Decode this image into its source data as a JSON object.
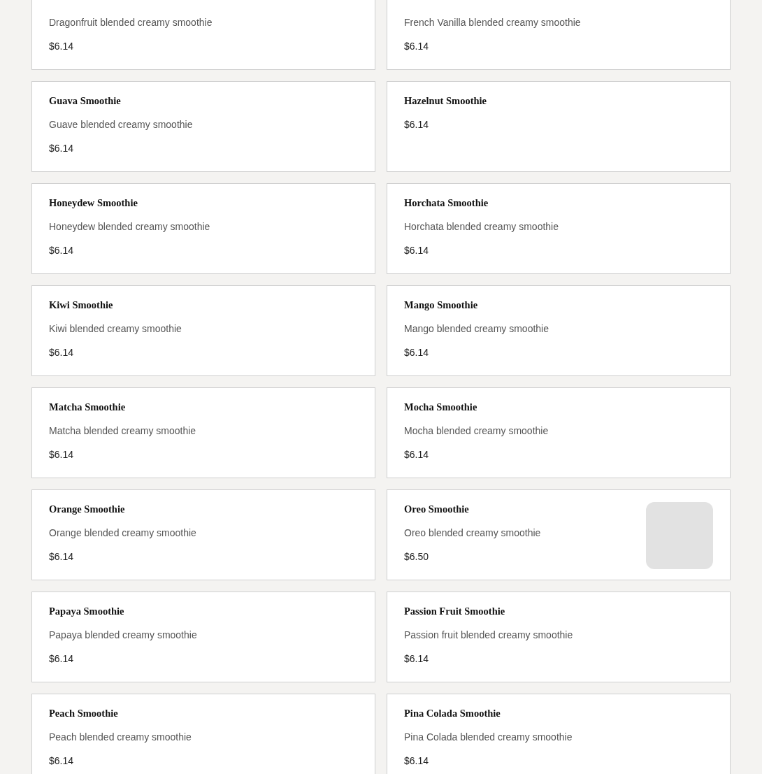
{
  "menu_items": [
    {
      "description": "Dragonfruit blended creamy smoothie",
      "price": "$6.14"
    },
    {
      "description": "French Vanilla blended creamy smoothie",
      "price": "$6.14"
    },
    {
      "name": "Guava Smoothie",
      "description": "Guave blended creamy smoothie",
      "price": "$6.14"
    },
    {
      "name": "Hazelnut Smoothie",
      "price": "$6.14"
    },
    {
      "name": "Honeydew Smoothie",
      "description": "Honeydew blended creamy smoothie",
      "price": "$6.14"
    },
    {
      "name": "Horchata Smoothie",
      "description": "Horchata blended creamy smoothie",
      "price": "$6.14"
    },
    {
      "name": "Kiwi Smoothie",
      "description": "Kiwi blended creamy smoothie",
      "price": "$6.14"
    },
    {
      "name": "Mango Smoothie",
      "description": "Mango blended creamy smoothie",
      "price": "$6.14"
    },
    {
      "name": "Matcha Smoothie",
      "description": "Matcha blended creamy smoothie",
      "price": "$6.14"
    },
    {
      "name": "Mocha Smoothie",
      "description": "Mocha blended creamy smoothie",
      "price": "$6.14"
    },
    {
      "name": "Orange Smoothie",
      "description": "Orange blended creamy smoothie",
      "price": "$6.14"
    },
    {
      "name": "Oreo Smoothie",
      "description": "Oreo blended creamy smoothie",
      "price": "$6.50",
      "photo": true
    },
    {
      "name": "Papaya Smoothie",
      "description": "Papaya blended creamy smoothie",
      "price": "$6.14"
    },
    {
      "name": "Passion Fruit Smoothie",
      "description": "Passion fruit blended creamy smoothie",
      "price": "$6.14"
    },
    {
      "name": "Peach Smoothie",
      "description": "Peach blended creamy smoothie",
      "price": "$6.14"
    },
    {
      "name": "Pina Colada Smoothie",
      "description": "Pina Colada blended creamy smoothie",
      "price": "$6.14"
    }
  ]
}
